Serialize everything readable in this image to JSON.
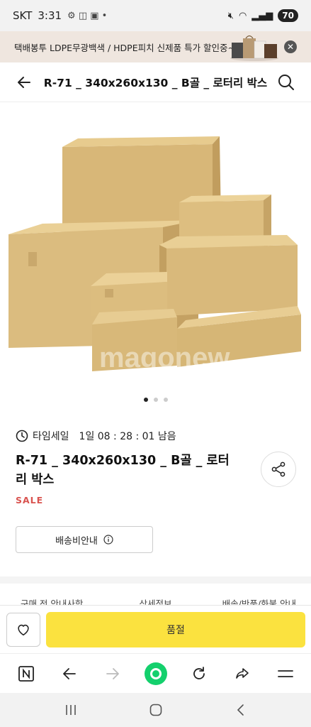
{
  "status_bar": {
    "carrier": "SKT",
    "time": "3:31",
    "battery": "70"
  },
  "promo": {
    "text": "택배봉투 LDPE무광백색 / HDPE피치 신제품 특가 할인중~!!"
  },
  "header": {
    "title": "R-71 _ 340x260x130 _ B골 _ 로터리 박스"
  },
  "product": {
    "timesale_label": "타임세일",
    "timesale_remaining": "1일 08 : 28 : 01 남음",
    "name": "R-71 _ 340x260x130 _ B골 _ 로터리 박스",
    "badge": "SALE",
    "shipping_info_label": "배송비안내",
    "watermark": "magonew"
  },
  "tabs": [
    "구매 전 안내사항",
    "상세정보",
    "배송/반품/화불 안내"
  ],
  "actions": {
    "soldout_label": "품절"
  },
  "icons": {
    "back": "arrow-left-icon",
    "search": "search-icon",
    "share": "share-icon",
    "wish": "heart-icon",
    "clock": "clock-icon",
    "info": "info-icon"
  },
  "colors": {
    "sale": "#d9534f",
    "soldout_bg": "#fbe23f",
    "promo_bg": "#efe6df"
  }
}
